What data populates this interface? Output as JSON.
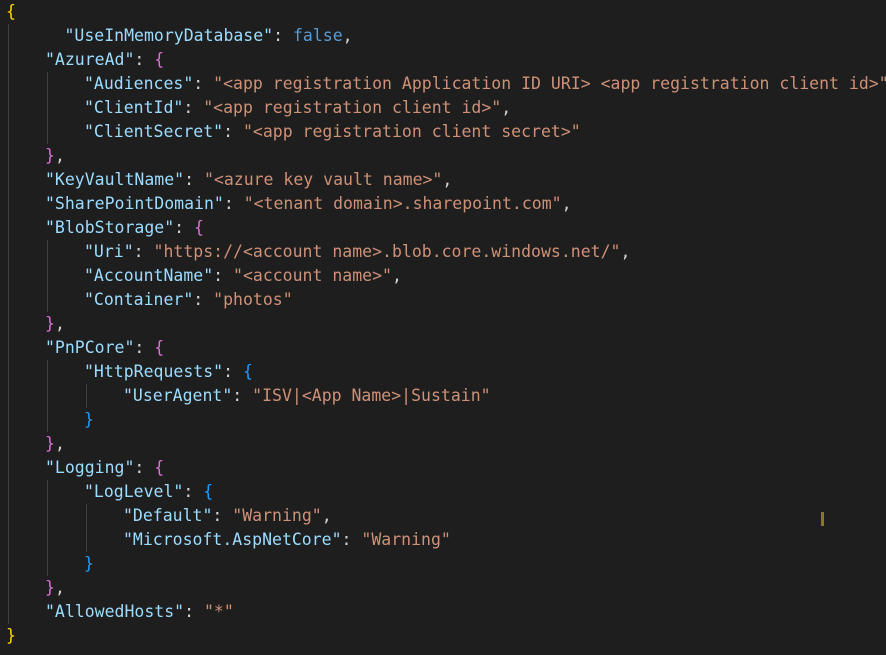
{
  "editor": {
    "language": "json",
    "colors": {
      "background": "#1e1e1e",
      "key": "#9cdcfe",
      "string": "#ce9178",
      "boolean": "#569cd6",
      "punctuation": "#d4d4d4",
      "bracket_level_1": "#ffd700",
      "bracket_level_2": "#da70d6",
      "bracket_level_3": "#179fff"
    },
    "lines": [
      [
        {
          "t": "b1",
          "v": "{"
        }
      ],
      [
        {
          "t": "key",
          "v": "\"UseInMemoryDatabase\""
        },
        {
          "t": "punc",
          "v": ": "
        },
        {
          "t": "bool",
          "v": "false"
        },
        {
          "t": "punc",
          "v": ","
        }
      ],
      [
        {
          "t": "key",
          "v": "\"AzureAd\""
        },
        {
          "t": "punc",
          "v": ": "
        },
        {
          "t": "b2",
          "v": "{"
        }
      ],
      [
        {
          "t": "key",
          "v": "\"Audiences\""
        },
        {
          "t": "punc",
          "v": ": "
        },
        {
          "t": "str",
          "v": "\"<app registration Application ID URI> <app registration client id>\""
        },
        {
          "t": "punc",
          "v": ","
        }
      ],
      [
        {
          "t": "key",
          "v": "\"ClientId\""
        },
        {
          "t": "punc",
          "v": ": "
        },
        {
          "t": "str",
          "v": "\"<app registration client id>\""
        },
        {
          "t": "punc",
          "v": ","
        }
      ],
      [
        {
          "t": "key",
          "v": "\"ClientSecret\""
        },
        {
          "t": "punc",
          "v": ": "
        },
        {
          "t": "str",
          "v": "\"<app registration client secret>\""
        }
      ],
      [
        {
          "t": "b2",
          "v": "}"
        },
        {
          "t": "punc",
          "v": ","
        }
      ],
      [
        {
          "t": "key",
          "v": "\"KeyVaultName\""
        },
        {
          "t": "punc",
          "v": ": "
        },
        {
          "t": "str",
          "v": "\"<azure key vault name>\""
        },
        {
          "t": "punc",
          "v": ","
        }
      ],
      [
        {
          "t": "key",
          "v": "\"SharePointDomain\""
        },
        {
          "t": "punc",
          "v": ": "
        },
        {
          "t": "str",
          "v": "\"<tenant domain>.sharepoint.com\""
        },
        {
          "t": "punc",
          "v": ","
        }
      ],
      [
        {
          "t": "key",
          "v": "\"BlobStorage\""
        },
        {
          "t": "punc",
          "v": ": "
        },
        {
          "t": "b2",
          "v": "{"
        }
      ],
      [
        {
          "t": "key",
          "v": "\"Uri\""
        },
        {
          "t": "punc",
          "v": ": "
        },
        {
          "t": "str",
          "v": "\"https://<account name>.blob.core.windows.net/\""
        },
        {
          "t": "punc",
          "v": ","
        }
      ],
      [
        {
          "t": "key",
          "v": "\"AccountName\""
        },
        {
          "t": "punc",
          "v": ": "
        },
        {
          "t": "str",
          "v": "\"<account name>\""
        },
        {
          "t": "punc",
          "v": ","
        }
      ],
      [
        {
          "t": "key",
          "v": "\"Container\""
        },
        {
          "t": "punc",
          "v": ": "
        },
        {
          "t": "str",
          "v": "\"photos\""
        }
      ],
      [
        {
          "t": "b2",
          "v": "}"
        },
        {
          "t": "punc",
          "v": ","
        }
      ],
      [
        {
          "t": "key",
          "v": "\"PnPCore\""
        },
        {
          "t": "punc",
          "v": ": "
        },
        {
          "t": "b2",
          "v": "{"
        }
      ],
      [
        {
          "t": "key",
          "v": "\"HttpRequests\""
        },
        {
          "t": "punc",
          "v": ": "
        },
        {
          "t": "b3",
          "v": "{"
        }
      ],
      [
        {
          "t": "key",
          "v": "\"UserAgent\""
        },
        {
          "t": "punc",
          "v": ": "
        },
        {
          "t": "str",
          "v": "\"ISV|<App Name>|Sustain\""
        }
      ],
      [
        {
          "t": "b3",
          "v": "}"
        }
      ],
      [
        {
          "t": "b2",
          "v": "}"
        },
        {
          "t": "punc",
          "v": ","
        }
      ],
      [
        {
          "t": "key",
          "v": "\"Logging\""
        },
        {
          "t": "punc",
          "v": ": "
        },
        {
          "t": "b2",
          "v": "{"
        }
      ],
      [
        {
          "t": "key",
          "v": "\"LogLevel\""
        },
        {
          "t": "punc",
          "v": ": "
        },
        {
          "t": "b3",
          "v": "{"
        }
      ],
      [
        {
          "t": "key",
          "v": "\"Default\""
        },
        {
          "t": "punc",
          "v": ": "
        },
        {
          "t": "str",
          "v": "\"Warning\""
        },
        {
          "t": "punc",
          "v": ","
        }
      ],
      [
        {
          "t": "key",
          "v": "\"Microsoft.AspNetCore\""
        },
        {
          "t": "punc",
          "v": ": "
        },
        {
          "t": "str",
          "v": "\"Warning\""
        }
      ],
      [
        {
          "t": "b3",
          "v": "}"
        }
      ],
      [
        {
          "t": "b2",
          "v": "}"
        },
        {
          "t": "punc",
          "v": ","
        }
      ],
      [
        {
          "t": "key",
          "v": "\"AllowedHosts\""
        },
        {
          "t": "punc",
          "v": ": "
        },
        {
          "t": "str",
          "v": "\"*\""
        }
      ],
      [
        {
          "t": "b1",
          "v": "}"
        }
      ]
    ]
  }
}
